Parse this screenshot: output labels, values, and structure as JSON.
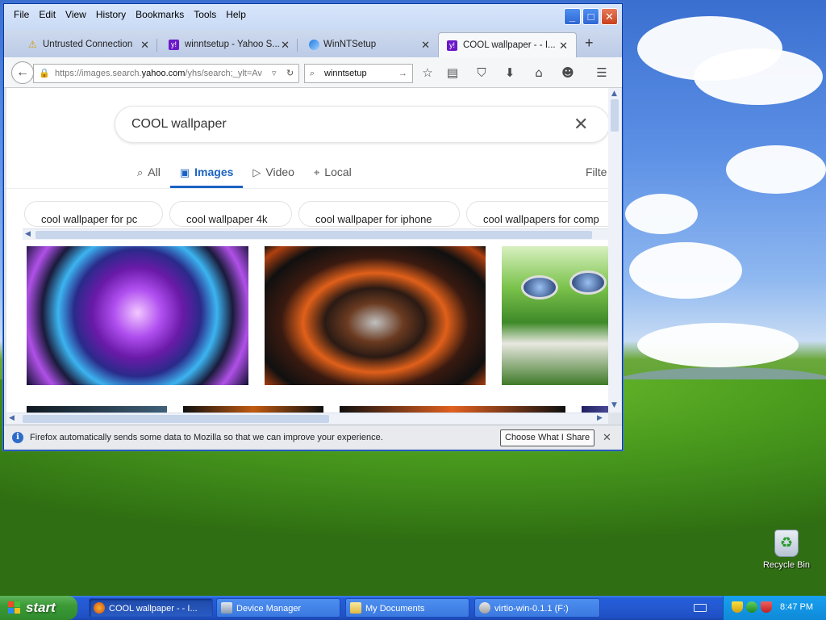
{
  "desktop": {
    "recycle_bin_label": "Recycle Bin"
  },
  "taskbar": {
    "start_label": "start",
    "buttons": [
      {
        "label": "COOL wallpaper - - I...",
        "icon": "firefox-icon",
        "active": true
      },
      {
        "label": "Device Manager",
        "icon": "device-manager-icon",
        "active": false
      },
      {
        "label": "My Documents",
        "icon": "folder-icon",
        "active": false
      },
      {
        "label": "virtio-win-0.1.1 (F:)",
        "icon": "drive-icon",
        "active": false
      }
    ],
    "clock": "8:47 PM"
  },
  "window": {
    "menu": [
      "File",
      "Edit",
      "View",
      "History",
      "Bookmarks",
      "Tools",
      "Help"
    ],
    "tabs": [
      {
        "label": "Untrusted Connection",
        "icon": "warning-icon",
        "selected": false
      },
      {
        "label": "winntsetup - Yahoo S...",
        "icon": "yahoo-icon",
        "selected": false
      },
      {
        "label": "WinNTSetup",
        "icon": "winntsetup-icon",
        "selected": false
      },
      {
        "label": "COOL wallpaper - - I...",
        "icon": "yahoo-icon",
        "selected": true
      }
    ],
    "new_tab": "+",
    "url_prefix": "https://images.search.",
    "url_domain": "yahoo.com",
    "url_suffix": "/yhs/search;_ylt=Av",
    "search_value": "winntsetup",
    "notification": "Firefox automatically sends some data to Mozilla so that we can improve your experience.",
    "notification_button": "Choose What I Share"
  },
  "page": {
    "query": "COOL wallpaper",
    "tabs": [
      {
        "label": "All",
        "icon": "search-icon",
        "selected": false
      },
      {
        "label": "Images",
        "icon": "image-icon",
        "selected": true
      },
      {
        "label": "Video",
        "icon": "play-icon",
        "selected": false
      },
      {
        "label": "Local",
        "icon": "location-pin-icon",
        "selected": false
      }
    ],
    "filter_label": "Filte",
    "suggestions": [
      "cool wallpaper for pc",
      "cool wallpaper 4k",
      "cool wallpaper for iphone",
      "cool wallpapers for comp"
    ],
    "results": [
      {
        "desc_icon": "image-result-purple-swirl"
      },
      {
        "desc_icon": "image-result-orange-abstract"
      },
      {
        "desc_icon": "image-result-green-mushroom"
      }
    ]
  },
  "colors": {
    "accent": "#1a63c2",
    "xp_blue": "#245edb",
    "start_green": "#3c9a37"
  }
}
